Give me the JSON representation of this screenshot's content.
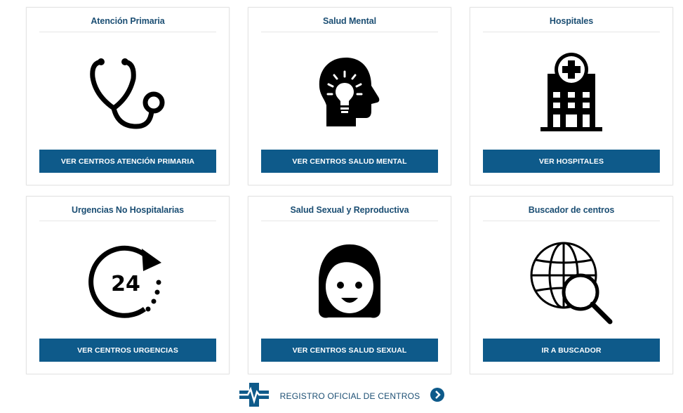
{
  "cards": [
    {
      "title": "Atención Primaria",
      "button": "VER CENTROS ATENCIÓN PRIMARIA",
      "icon": "stethoscope-icon"
    },
    {
      "title": "Salud Mental",
      "button": "VER CENTROS SALUD MENTAL",
      "icon": "head-lightbulb-icon"
    },
    {
      "title": "Hospitales",
      "button": "VER HOSPITALES",
      "icon": "hospital-building-icon"
    },
    {
      "title": "Urgencias No Hospitalarias",
      "button": "VER CENTROS URGENCIAS",
      "icon": "24-hours-icon"
    },
    {
      "title": "Salud Sexual y Reproductiva",
      "button": "VER CENTROS SALUD SEXUAL",
      "icon": "woman-face-icon"
    },
    {
      "title": "Buscador de centros",
      "button": "IR A BUSCADOR",
      "icon": "globe-search-icon"
    }
  ],
  "icon_24": "24",
  "footer": {
    "label": "REGISTRO OFICIAL DE CENTROS",
    "logo_icon": "medical-cross-heartbeat-icon",
    "arrow_icon": "chevron-right-circle-icon"
  },
  "colors": {
    "title": "#1b4e73",
    "button": "#0e5a8a",
    "icon": "#000000"
  }
}
